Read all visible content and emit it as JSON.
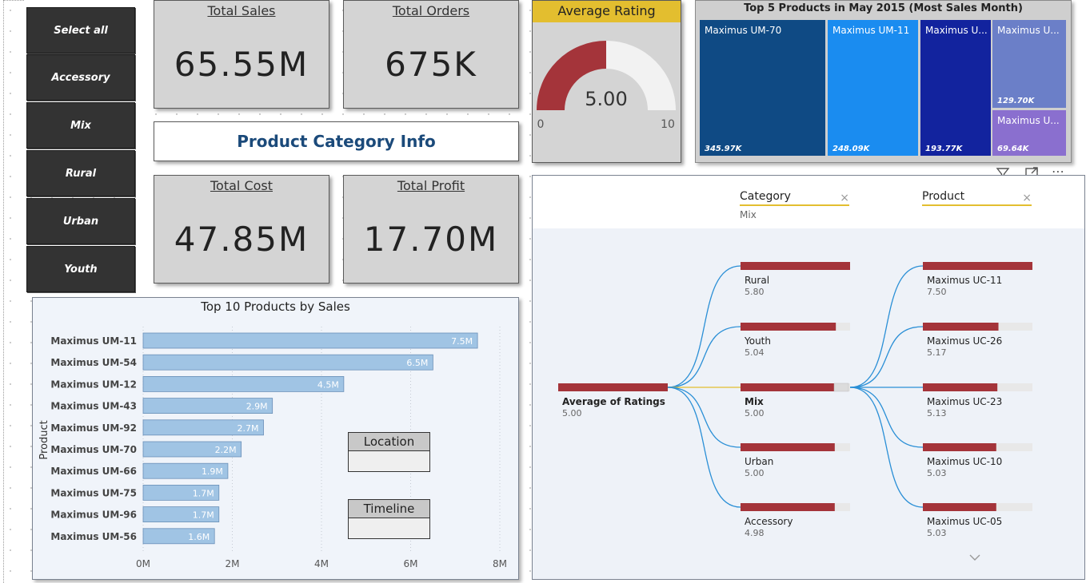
{
  "slicer": {
    "buttons": [
      "Select all",
      "Accessory",
      "Mix",
      "Rural",
      "Urban",
      "Youth"
    ]
  },
  "kpis": {
    "total_sales": {
      "label": "Total Sales",
      "value": "65.55M"
    },
    "total_orders": {
      "label": "Total Orders",
      "value": "675K"
    },
    "total_cost": {
      "label": "Total Cost",
      "value": "47.85M"
    },
    "total_profit": {
      "label": "Total Profit",
      "value": "17.70M"
    }
  },
  "banner": {
    "text": "Product Category Info"
  },
  "gauge": {
    "title": "Average Rating",
    "value_label": "5.00",
    "value": 5.0,
    "min_label": "0",
    "max_label": "10",
    "min": 0,
    "max": 10,
    "fill_color": "#a4343a",
    "track_color": "#f2f2f2"
  },
  "treemap": {
    "title": "Top 5 Products in May 2015 (Most Sales Month)",
    "tiles": [
      {
        "name": "Maximus UM-70",
        "value": "345.97K",
        "color": "#0f4a84"
      },
      {
        "name": "Maximus UM-11",
        "value": "248.09K",
        "color": "#1a8cf0"
      },
      {
        "name": "Maximus U...",
        "value": "193.77K",
        "color": "#12239e"
      },
      {
        "name": "Maximus U...",
        "value": "129.70K",
        "color": "#6b7fc8"
      },
      {
        "name": "Maximus U...",
        "value": "69.64K",
        "color": "#8a6fcf"
      }
    ]
  },
  "chart_data": {
    "type": "bar",
    "title": "Top 10 Products by Sales",
    "ylabel": "Product",
    "xlabel": "",
    "categories": [
      "Maximus UM-11",
      "Maximus UM-54",
      "Maximus UM-12",
      "Maximus UM-43",
      "Maximus UM-92",
      "Maximus UM-70",
      "Maximus UM-66",
      "Maximus UM-75",
      "Maximus UM-96",
      "Maximus UM-56"
    ],
    "values": [
      7.5,
      6.5,
      4.5,
      2.9,
      2.7,
      2.2,
      1.9,
      1.7,
      1.7,
      1.6
    ],
    "value_labels": [
      "7.5M",
      "6.5M",
      "4.5M",
      "2.9M",
      "2.7M",
      "2.2M",
      "1.9M",
      "1.7M",
      "1.7M",
      "1.6M"
    ],
    "x_ticks": [
      "0M",
      "2M",
      "4M",
      "6M",
      "8M"
    ],
    "xlim": [
      0,
      8
    ],
    "bar_color": "#a0c4e4",
    "grid": true
  },
  "filters": {
    "location": "Location",
    "timeline": "Timeline"
  },
  "decomp": {
    "levels": [
      {
        "title": "Category",
        "value": "Mix"
      },
      {
        "title": "Product",
        "value": ""
      }
    ],
    "close_glyph": "×",
    "root": {
      "label": "Average of Ratings",
      "value": "5.00",
      "fraction": 1.0
    },
    "categories": [
      {
        "label": "Rural",
        "value": "5.80",
        "fraction": 1.0
      },
      {
        "label": "Youth",
        "value": "5.04",
        "fraction": 0.87
      },
      {
        "label": "Mix",
        "value": "5.00",
        "fraction": 0.86,
        "selected": true
      },
      {
        "label": "Urban",
        "value": "5.00",
        "fraction": 0.86
      },
      {
        "label": "Accessory",
        "value": "4.98",
        "fraction": 0.86
      }
    ],
    "products": [
      {
        "label": "Maximus UC-11",
        "value": "7.50",
        "fraction": 1.0
      },
      {
        "label": "Maximus UC-26",
        "value": "5.17",
        "fraction": 0.69
      },
      {
        "label": "Maximus UC-23",
        "value": "5.13",
        "fraction": 0.68
      },
      {
        "label": "Maximus UC-10",
        "value": "5.03",
        "fraction": 0.67
      },
      {
        "label": "Maximus UC-05",
        "value": "5.03",
        "fraction": 0.67
      }
    ],
    "bar_color": "#a4343a",
    "track_color": "#e8e8e8",
    "link_color": "#2a8fd6",
    "selected_link_color": "#e3be2f"
  }
}
